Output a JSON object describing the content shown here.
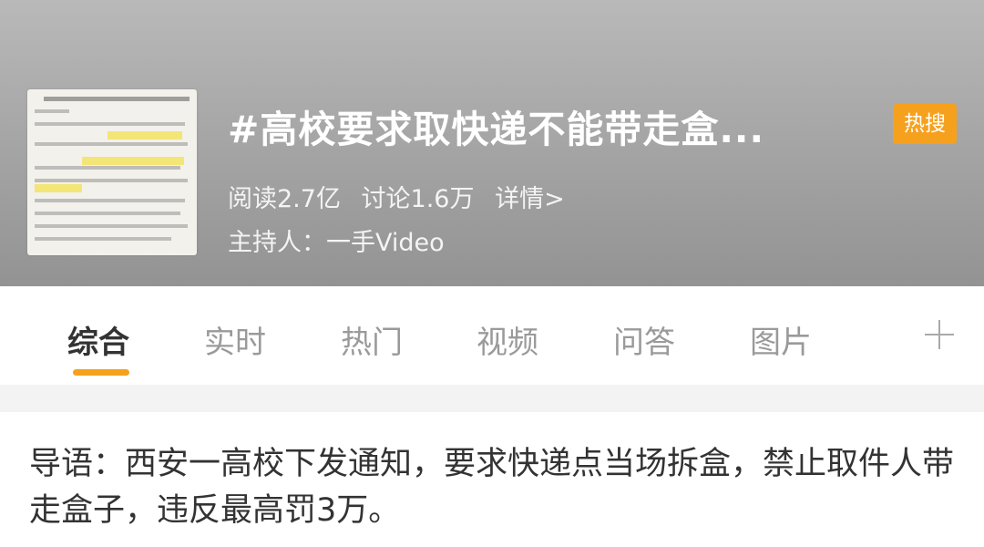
{
  "header": {
    "title": "#高校要求取快递不能带走盒...",
    "badge": "热搜",
    "reads": "阅读2.7亿",
    "discussions": "讨论1.6万",
    "details_link": "详情>",
    "host": "主持人：一手Video"
  },
  "tabs": [
    {
      "label": "综合",
      "active": true
    },
    {
      "label": "实时",
      "active": false
    },
    {
      "label": "热门",
      "active": false
    },
    {
      "label": "视频",
      "active": false
    },
    {
      "label": "问答",
      "active": false
    },
    {
      "label": "图片",
      "active": false
    }
  ],
  "intro": {
    "text": "导语：西安一高校下发通知，要求快递点当场拆盒，禁止取件人带走盒子，违反最高罚3万。"
  },
  "colors": {
    "accent_orange": "#f6a11d",
    "active_tab_text": "#333333",
    "inactive_tab_text": "#9a9a9a"
  },
  "icons": {
    "add_tab": "plus-icon",
    "thumbnail": "document-thumbnail"
  }
}
